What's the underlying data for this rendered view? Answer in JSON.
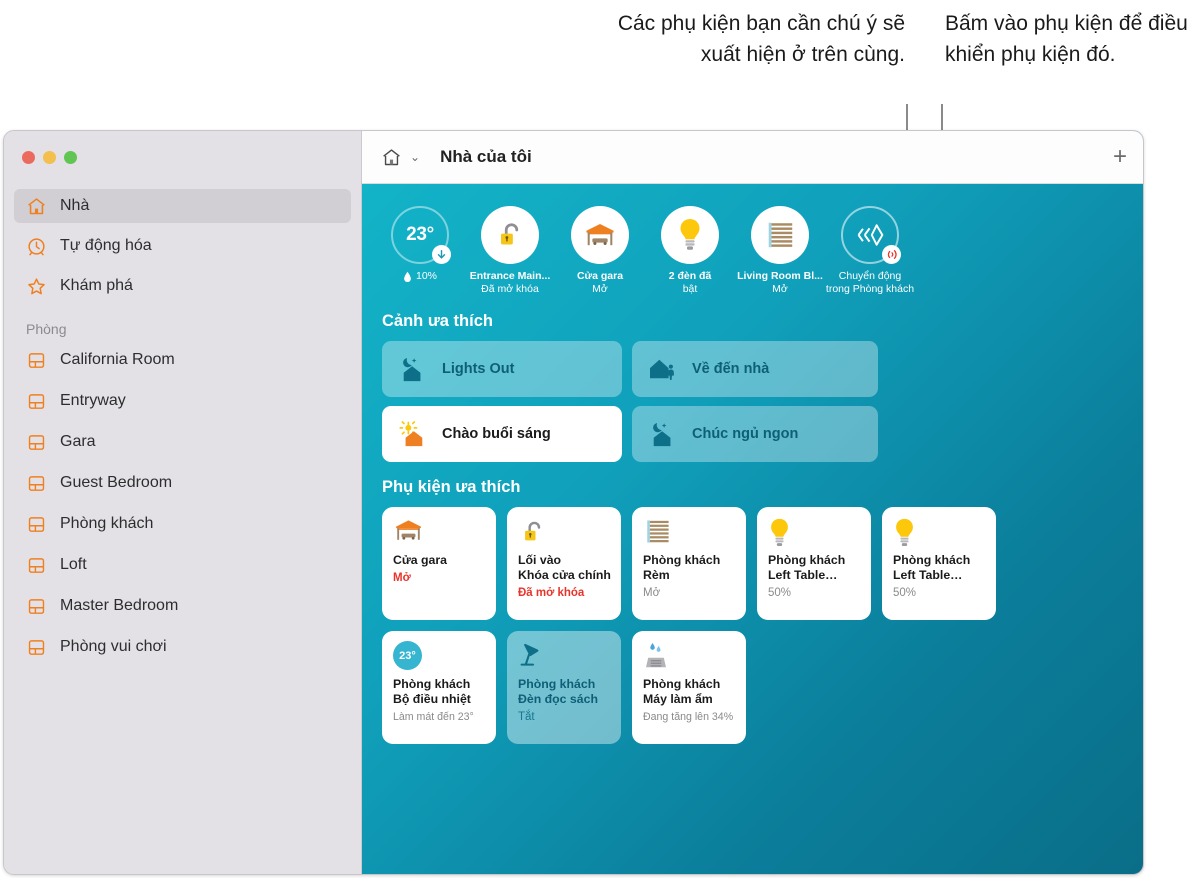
{
  "callouts": {
    "left": "Các phụ kiện bạn cần chú ý sẽ xuất hiện ở trên cùng.",
    "right": "Bấm vào phụ kiện để điều khiển phụ kiện đó."
  },
  "sidebar": {
    "nav": [
      {
        "label": "Nhà",
        "icon": "home-icon",
        "selected": true
      },
      {
        "label": "Tự động hóa",
        "icon": "automation-clock-icon",
        "selected": false
      },
      {
        "label": "Khám phá",
        "icon": "star-icon",
        "selected": false
      }
    ],
    "section_label": "Phòng",
    "rooms": [
      {
        "label": "California Room",
        "icon": "room-icon"
      },
      {
        "label": "Entryway",
        "icon": "room-icon"
      },
      {
        "label": "Gara",
        "icon": "room-icon"
      },
      {
        "label": "Guest Bedroom",
        "icon": "room-icon"
      },
      {
        "label": "Phòng khách",
        "icon": "room-icon"
      },
      {
        "label": "Loft",
        "icon": "room-icon"
      },
      {
        "label": "Master Bedroom",
        "icon": "room-icon"
      },
      {
        "label": "Phòng vui chơi",
        "icon": "room-icon"
      }
    ]
  },
  "toolbar": {
    "home_icon": "home-outline-icon",
    "chevron": "⌄",
    "title": "Nhà của tôi",
    "add_label": "+"
  },
  "status": [
    {
      "type": "temperature",
      "value": "23°",
      "badge": "down-arrow-icon",
      "sub1": "10%",
      "sub2": "",
      "icon": "humidity-drop-icon"
    },
    {
      "type": "lock",
      "icon": "unlocked-padlock-icon",
      "sub1": "Entrance Main...",
      "sub2": "Đã mở khóa"
    },
    {
      "type": "garage",
      "icon": "garage-door-icon",
      "sub1": "Cửa gara",
      "sub2": "Mở"
    },
    {
      "type": "light",
      "icon": "lightbulb-icon",
      "sub1": "2 đèn đã",
      "sub2": "bật"
    },
    {
      "type": "blinds",
      "icon": "window-blinds-icon",
      "sub1": "Living Room Bl...",
      "sub2": "Mở"
    },
    {
      "type": "motion",
      "icon": "motion-sensor-icon",
      "badge": "wireless-alert-icon",
      "sub1": "Chuyển động",
      "sub2": "trong Phòng khách"
    }
  ],
  "scenes": {
    "title": "Cảnh ưa thích",
    "items": [
      {
        "label": "Lights Out",
        "icon": "moon-house-icon",
        "active": false
      },
      {
        "label": "Về đến nhà",
        "icon": "house-person-icon",
        "active": false
      },
      {
        "label": "Chào buổi sáng",
        "icon": "sun-house-icon",
        "active": true
      },
      {
        "label": "Chúc ngủ ngon",
        "icon": "moon-house-icon",
        "active": false
      }
    ]
  },
  "accessories": {
    "title": "Phụ kiện ưa thích",
    "items": [
      {
        "icon": "garage-door-icon",
        "name_line1": "Cửa gara",
        "name_line2": "",
        "state": "Mở",
        "state_style": "alert",
        "off": false
      },
      {
        "icon": "unlocked-padlock-icon",
        "name_line1": "Lối vào",
        "name_line2": "Khóa cửa chính",
        "state": "Đã mở khóa",
        "state_style": "alert",
        "off": false
      },
      {
        "icon": "window-blinds-icon",
        "name_line1": "Phòng khách",
        "name_line2": "Rèm",
        "state": "Mở",
        "state_style": "normal",
        "off": false
      },
      {
        "icon": "lightbulb-icon",
        "name_line1": "Phòng khách",
        "name_line2": "Left Table…",
        "state": "50%",
        "state_style": "normal",
        "off": false
      },
      {
        "icon": "lightbulb-icon",
        "name_line1": "Phòng khách",
        "name_line2": "Left Table…",
        "state": "50%",
        "state_style": "normal",
        "off": false
      },
      {
        "icon": "thermostat-icon",
        "icon_value": "23°",
        "name_line1": "Phòng khách",
        "name_line2": "Bộ điều nhiệt",
        "state": "Làm mát đến 23°",
        "state_style": "normal",
        "off": false
      },
      {
        "icon": "desk-lamp-icon",
        "name_line1": "Phòng khách",
        "name_line2": "Đèn đọc sách",
        "state": "Tắt",
        "state_style": "normal",
        "off": true
      },
      {
        "icon": "humidifier-icon",
        "name_line1": "Phòng khách",
        "name_line2": "Máy làm ẩm",
        "state": "Đang tăng lên 34%",
        "state_style": "normal",
        "off": false
      }
    ]
  },
  "colors": {
    "accent_orange": "#ef8022",
    "alert_red": "#e8342b",
    "teal_light": "#13b5c9",
    "teal_dark": "#0a6e88",
    "bulb_yellow": "#fdc70c"
  }
}
